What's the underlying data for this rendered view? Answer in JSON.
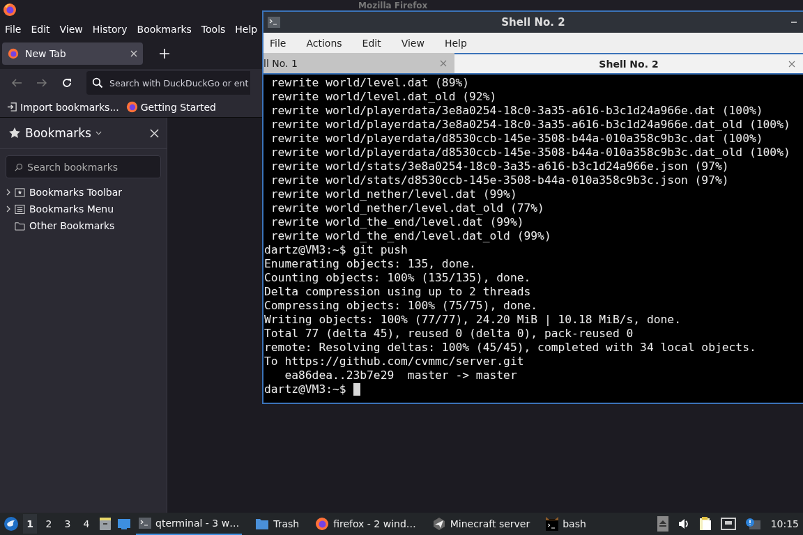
{
  "firefox": {
    "title": "Mozilla Firefox",
    "menu": [
      "File",
      "Edit",
      "View",
      "History",
      "Bookmarks",
      "Tools",
      "Help"
    ],
    "tabs": [
      {
        "label": "New Tab",
        "selected": true
      }
    ],
    "search": {
      "placeholder": "Search with DuckDuckGo or ent"
    },
    "bookmarks_toolbar": [
      {
        "kind": "import",
        "label": "Import bookmarks..."
      },
      {
        "kind": "firefox",
        "label": "Getting Started"
      }
    ],
    "sidebar": {
      "title": "Bookmarks",
      "search": {
        "placeholder": "Search bookmarks"
      },
      "items": [
        {
          "kind": "toolbar",
          "label": "Bookmarks Toolbar"
        },
        {
          "kind": "menu",
          "label": "Bookmarks Menu"
        },
        {
          "kind": "folder",
          "label": "Other Bookmarks"
        }
      ]
    }
  },
  "terminal": {
    "title": "Shell No. 2",
    "menu": [
      "File",
      "Actions",
      "Edit",
      "View",
      "Help"
    ],
    "tabs": [
      {
        "label": "ll No. 1",
        "selected": false
      },
      {
        "label": "Shell No. 2",
        "selected": true
      }
    ],
    "lines": [
      " rewrite world/level.dat (89%)",
      " rewrite world/level.dat_old (92%)",
      " rewrite world/playerdata/3e8a0254-18c0-3a35-a616-b3c1d24a966e.dat (100%)",
      " rewrite world/playerdata/3e8a0254-18c0-3a35-a616-b3c1d24a966e.dat_old (100%)",
      " rewrite world/playerdata/d8530ccb-145e-3508-b44a-010a358c9b3c.dat (100%)",
      " rewrite world/playerdata/d8530ccb-145e-3508-b44a-010a358c9b3c.dat_old (100%)",
      " rewrite world/stats/3e8a0254-18c0-3a35-a616-b3c1d24a966e.json (97%)",
      " rewrite world/stats/d8530ccb-145e-3508-b44a-010a358c9b3c.json (97%)",
      " rewrite world_nether/level.dat (99%)",
      " rewrite world_nether/level.dat_old (77%)",
      " rewrite world_the_end/level.dat (99%)",
      " rewrite world_the_end/level.dat_old (99%)",
      "dartz@VM3:~$ git push",
      "Enumerating objects: 135, done.",
      "Counting objects: 100% (135/135), done.",
      "Delta compression using up to 2 threads",
      "Compressing objects: 100% (75/75), done.",
      "Writing objects: 100% (77/77), 24.20 MiB | 10.18 MiB/s, done.",
      "Total 77 (delta 45), reused 0 (delta 0), pack-reused 0",
      "remote: Resolving deltas: 100% (45/45), completed with 34 local objects.",
      "To https://github.com/cvmmc/server.git",
      "   ea86dea..23b7e29  master -> master"
    ],
    "prompt": "dartz@VM3:~$"
  },
  "taskbar": {
    "desktops": [
      {
        "label": "1",
        "selected": true
      },
      {
        "label": "2",
        "selected": false
      },
      {
        "label": "3",
        "selected": false
      },
      {
        "label": "4",
        "selected": false
      }
    ],
    "tasks": [
      {
        "kind": "terminal",
        "label": "qterminal - 3 w…",
        "selected": true
      },
      {
        "kind": "folder",
        "label": "Trash",
        "selected": false
      },
      {
        "kind": "firefox",
        "label": "firefox - 2 wind…",
        "selected": false
      },
      {
        "kind": "plane",
        "label": "Minecraft server",
        "selected": false
      },
      {
        "kind": "bash",
        "label": "bash",
        "selected": false
      }
    ],
    "clock": "10:15"
  }
}
